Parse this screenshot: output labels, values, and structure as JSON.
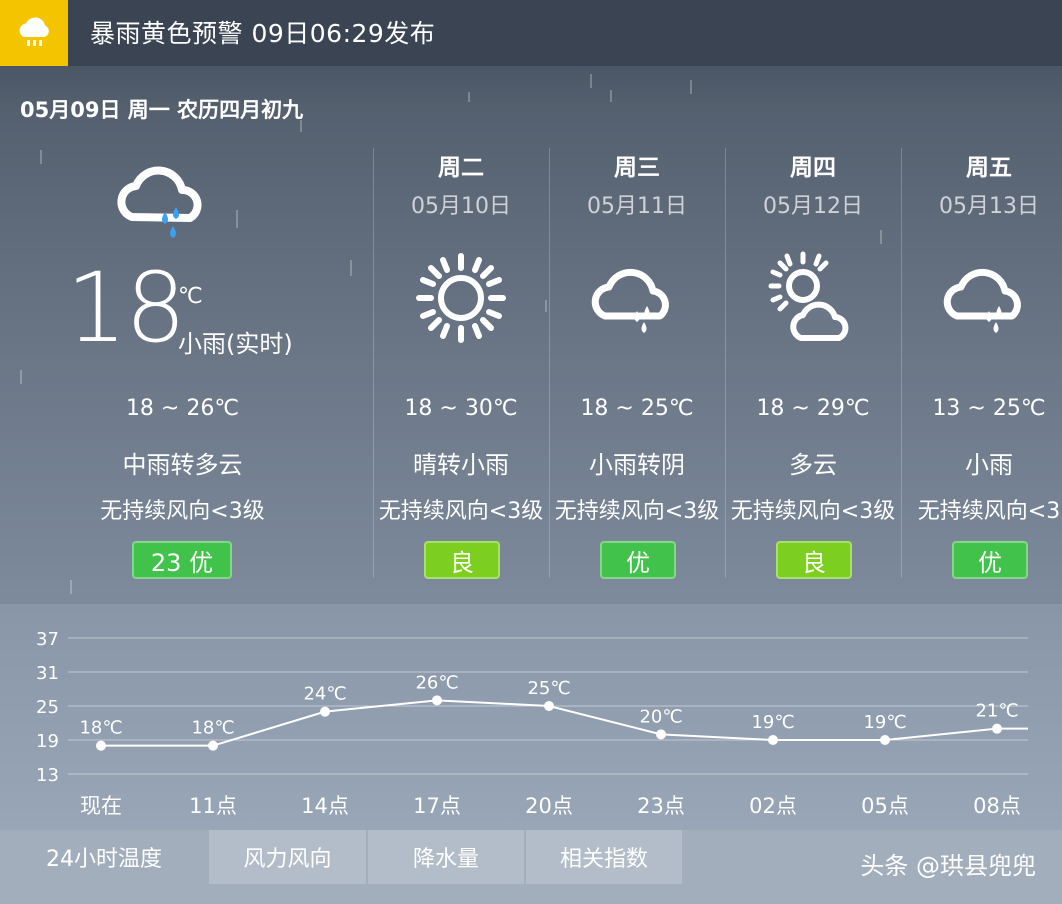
{
  "warning": {
    "title": "暴雨黄色预警 09日06:29发布",
    "icon": "rain-warning-icon",
    "color": "#f4c400"
  },
  "today": {
    "date_line": "05月09日 周一 农历四月初九",
    "temp": "18",
    "unit": "℃",
    "desc": "小雨(实时)",
    "range": "18 ~ 26℃",
    "weather": "中雨转多云",
    "wind": "无持续风向<3级",
    "aqi": "23 优",
    "icon": "rain-cloud-icon"
  },
  "days": [
    {
      "week": "周二",
      "date": "05月10日",
      "icon": "sun-icon",
      "range": "18 ~ 30℃",
      "weather": "晴转小雨",
      "wind": "无持续风向<3级",
      "aqi": "良"
    },
    {
      "week": "周三",
      "date": "05月11日",
      "icon": "rain-cloud-icon",
      "range": "18 ~ 25℃",
      "weather": "小雨转阴",
      "wind": "无持续风向<3级",
      "aqi": "优"
    },
    {
      "week": "周四",
      "date": "05月12日",
      "icon": "partly-cloudy-icon",
      "range": "18 ~ 29℃",
      "weather": "多云",
      "wind": "无持续风向<3级",
      "aqi": "良"
    },
    {
      "week": "周五",
      "date": "05月13日",
      "icon": "rain-cloud-icon",
      "range": "13 ~ 25℃",
      "weather": "小雨",
      "wind": "无持续风向<3",
      "aqi": "优"
    }
  ],
  "chart_data": {
    "type": "line",
    "categories": [
      "现在",
      "11点",
      "14点",
      "17点",
      "20点",
      "23点",
      "02点",
      "05点",
      "08点"
    ],
    "values": [
      18,
      18,
      24,
      26,
      25,
      20,
      19,
      19,
      21
    ],
    "labels": [
      "18℃",
      "18℃",
      "24℃",
      "26℃",
      "25℃",
      "20℃",
      "19℃",
      "19℃",
      "21℃"
    ],
    "yticks": [
      37,
      31,
      25,
      19,
      13
    ],
    "ylim": [
      13,
      37
    ],
    "grid": true
  },
  "tabs": [
    "24小时温度",
    "风力风向",
    "降水量",
    "相关指数"
  ],
  "watermark": "头条 @珙县兜兜"
}
